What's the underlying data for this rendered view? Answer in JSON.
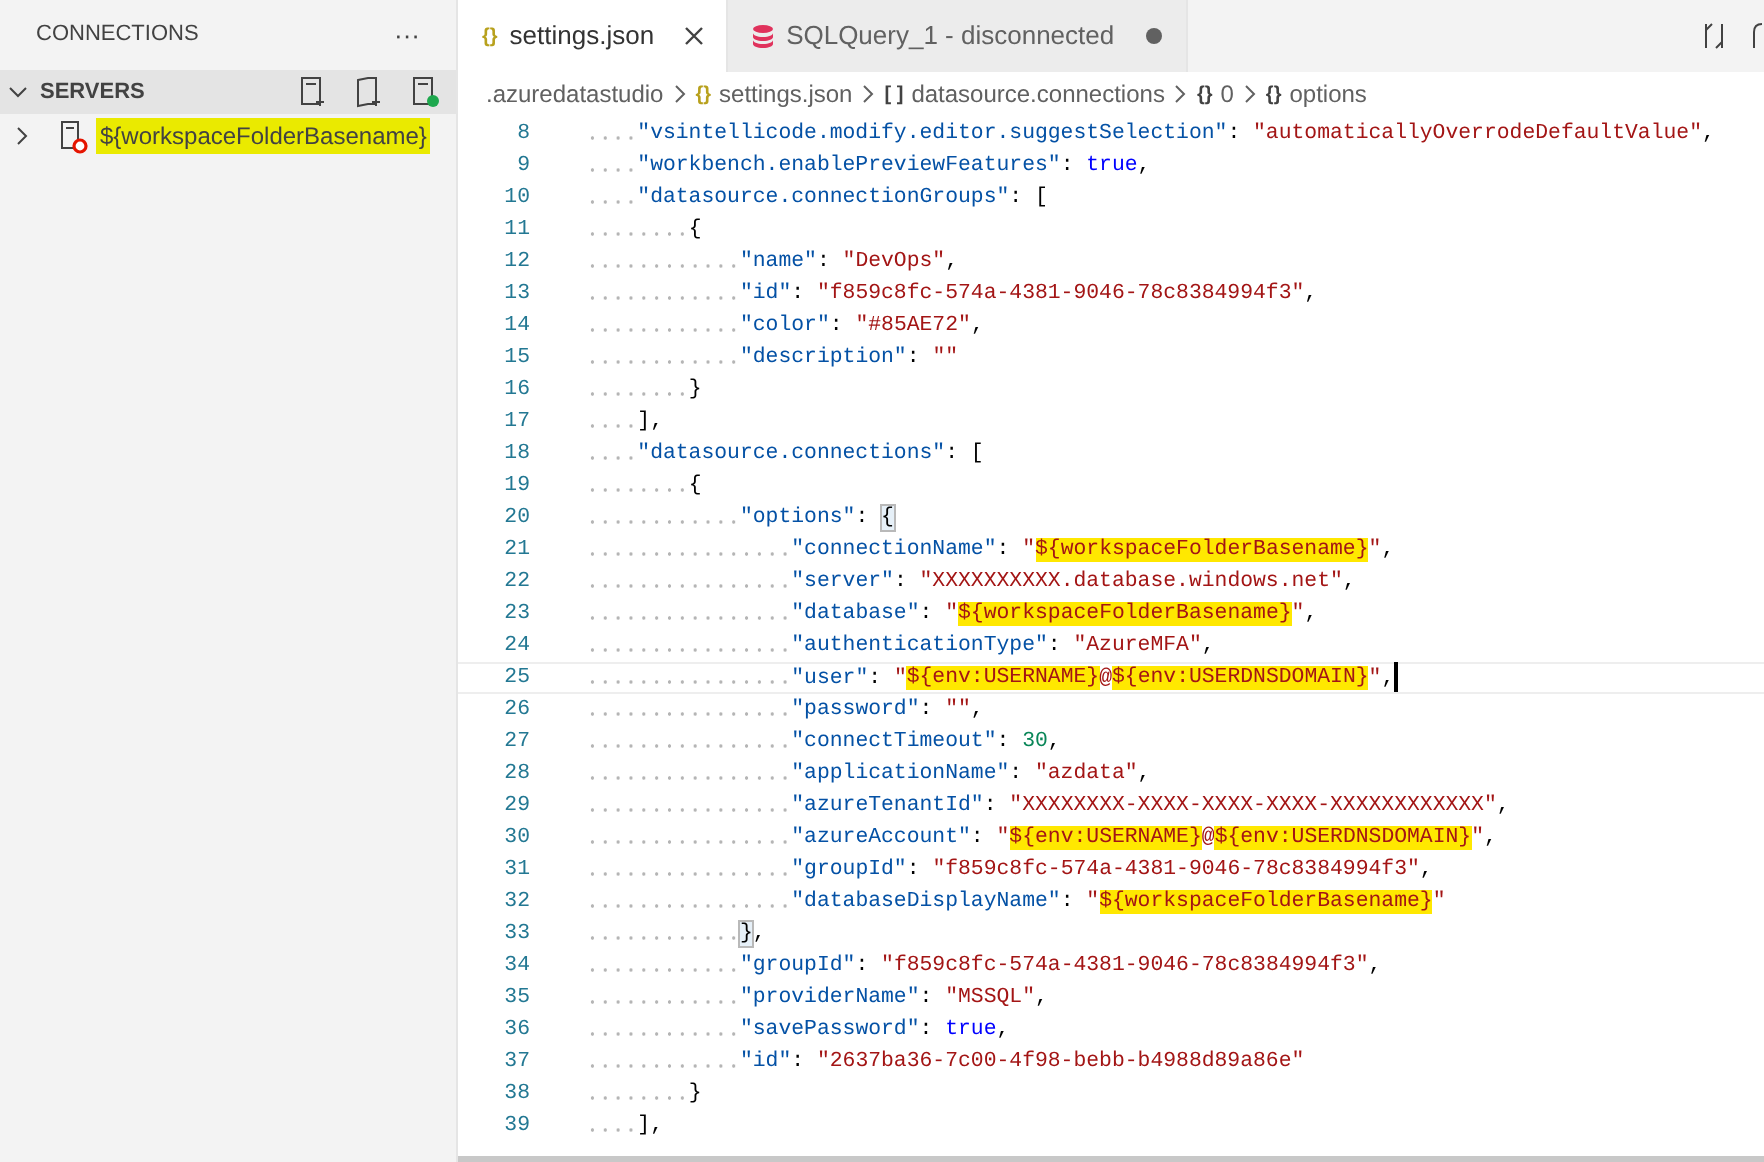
{
  "sidebar": {
    "title": "CONNECTIONS",
    "more": "···",
    "section": {
      "title": "SERVERS",
      "expanded": true
    },
    "items": [
      {
        "label": "${workspaceFolderBasename}",
        "expanded": false,
        "highlighted": true
      }
    ]
  },
  "tabs": [
    {
      "icon": "{}",
      "label": "settings.json",
      "selected": true,
      "kind": "json",
      "dirty": false
    },
    {
      "label": "SQLQuery_1 - disconnected",
      "selected": false,
      "kind": "sql",
      "dirty": true
    }
  ],
  "breadcrumbs": [
    {
      "label": ".azuredatastudio"
    },
    {
      "icon": "{}",
      "label": "settings.json"
    },
    {
      "icon": "[ ]",
      "label": "datasource.connections"
    },
    {
      "icon": "{}",
      "label": "0"
    },
    {
      "icon": "{}",
      "label": "options"
    }
  ],
  "lines": [
    {
      "n": "8",
      "current": false,
      "tokens": [
        {
          "kind": "key",
          "text": "\"vsintellicode.modify.editor.suggestSelection\""
        },
        {
          "kind": "punct",
          "text": ": "
        },
        {
          "kind": "string",
          "text": "\"automaticallyOverrodeDefaultValue\""
        },
        {
          "kind": "punct",
          "text": ","
        }
      ]
    },
    {
      "n": "9",
      "current": false,
      "tokens": [
        {
          "kind": "key",
          "text": "\"workbench.enablePreviewFeatures\""
        },
        {
          "kind": "punct",
          "text": ": "
        },
        {
          "kind": "keyword",
          "text": "true"
        },
        {
          "kind": "punct",
          "text": ","
        }
      ]
    },
    {
      "n": "10",
      "current": false,
      "tokens": [
        {
          "kind": "key",
          "text": "\"datasource.connectionGroups\""
        },
        {
          "kind": "punct",
          "text": ": ["
        }
      ]
    },
    {
      "n": "11",
      "current": false,
      "tokens": [
        {
          "kind": "punct",
          "text": "{"
        }
      ]
    },
    {
      "n": "12",
      "current": false,
      "tokens": [
        {
          "kind": "key",
          "text": "\"name\""
        },
        {
          "kind": "punct",
          "text": ": "
        },
        {
          "kind": "string",
          "text": "\"DevOps\""
        },
        {
          "kind": "punct",
          "text": ","
        }
      ]
    },
    {
      "n": "13",
      "current": false,
      "tokens": [
        {
          "kind": "key",
          "text": "\"id\""
        },
        {
          "kind": "punct",
          "text": ": "
        },
        {
          "kind": "string",
          "text": "\"f859c8fc-574a-4381-9046-78c8384994f3\""
        },
        {
          "kind": "punct",
          "text": ","
        }
      ]
    },
    {
      "n": "14",
      "current": false,
      "tokens": [
        {
          "kind": "key",
          "text": "\"color\""
        },
        {
          "kind": "punct",
          "text": ": "
        },
        {
          "kind": "string",
          "text": "\"#85AE72\""
        },
        {
          "kind": "punct",
          "text": ","
        }
      ]
    },
    {
      "n": "15",
      "current": false,
      "tokens": [
        {
          "kind": "key",
          "text": "\"description\""
        },
        {
          "kind": "punct",
          "text": ": "
        },
        {
          "kind": "string",
          "text": "\"\""
        }
      ]
    },
    {
      "n": "16",
      "current": false,
      "tokens": [
        {
          "kind": "punct",
          "text": "}"
        }
      ]
    },
    {
      "n": "17",
      "current": false,
      "tokens": [
        {
          "kind": "punct",
          "text": "],"
        }
      ]
    },
    {
      "n": "18",
      "current": false,
      "tokens": [
        {
          "kind": "key",
          "text": "\"datasource.connections\""
        },
        {
          "kind": "punct",
          "text": ": ["
        }
      ]
    },
    {
      "n": "19",
      "current": false,
      "tokens": [
        {
          "kind": "punct",
          "text": "{"
        }
      ]
    },
    {
      "n": "20",
      "current": false,
      "tokens": [
        {
          "kind": "key",
          "text": "\"options\""
        },
        {
          "kind": "punct",
          "text": ": "
        },
        {
          "kind": "match",
          "text": "{"
        }
      ]
    },
    {
      "n": "21",
      "current": false,
      "tokens": [
        {
          "kind": "key",
          "text": "\"connectionName\""
        },
        {
          "kind": "punct",
          "text": ": "
        },
        {
          "kind": "string",
          "text": "\""
        },
        {
          "kind": "highlight",
          "text": "${workspaceFolderBasename}"
        },
        {
          "kind": "string",
          "text": "\""
        },
        {
          "kind": "punct",
          "text": ","
        }
      ]
    },
    {
      "n": "22",
      "current": false,
      "tokens": [
        {
          "kind": "key",
          "text": "\"server\""
        },
        {
          "kind": "punct",
          "text": ": "
        },
        {
          "kind": "string",
          "text": "\"XXXXXXXXXX.database.windows.net\""
        },
        {
          "kind": "punct",
          "text": ","
        }
      ]
    },
    {
      "n": "23",
      "current": false,
      "tokens": [
        {
          "kind": "key",
          "text": "\"database\""
        },
        {
          "kind": "punct",
          "text": ": "
        },
        {
          "kind": "string",
          "text": "\""
        },
        {
          "kind": "highlight",
          "text": "${workspaceFolderBasename}"
        },
        {
          "kind": "string",
          "text": "\""
        },
        {
          "kind": "punct",
          "text": ","
        }
      ]
    },
    {
      "n": "24",
      "current": false,
      "tokens": [
        {
          "kind": "key",
          "text": "\"authenticationType\""
        },
        {
          "kind": "punct",
          "text": ": "
        },
        {
          "kind": "string",
          "text": "\"AzureMFA\""
        },
        {
          "kind": "punct",
          "text": ","
        }
      ]
    },
    {
      "n": "25",
      "current": true,
      "tokens": [
        {
          "kind": "key",
          "text": "\"user\""
        },
        {
          "kind": "punct",
          "text": ": "
        },
        {
          "kind": "string",
          "text": "\""
        },
        {
          "kind": "highlight",
          "text": "${env:USERNAME}"
        },
        {
          "kind": "string",
          "text": "@"
        },
        {
          "kind": "highlight",
          "text": "${env:USERDNSDOMAIN}"
        },
        {
          "kind": "string",
          "text": "\""
        },
        {
          "kind": "punct",
          "text": ","
        }
      ]
    },
    {
      "n": "26",
      "current": false,
      "tokens": [
        {
          "kind": "key",
          "text": "\"password\""
        },
        {
          "kind": "punct",
          "text": ": "
        },
        {
          "kind": "string",
          "text": "\"\""
        },
        {
          "kind": "punct",
          "text": ","
        }
      ]
    },
    {
      "n": "27",
      "current": false,
      "tokens": [
        {
          "kind": "key",
          "text": "\"connectTimeout\""
        },
        {
          "kind": "punct",
          "text": ": "
        },
        {
          "kind": "number",
          "text": "30"
        },
        {
          "kind": "punct",
          "text": ","
        }
      ]
    },
    {
      "n": "28",
      "current": false,
      "tokens": [
        {
          "kind": "key",
          "text": "\"applicationName\""
        },
        {
          "kind": "punct",
          "text": ": "
        },
        {
          "kind": "string",
          "text": "\"azdata\""
        },
        {
          "kind": "punct",
          "text": ","
        }
      ]
    },
    {
      "n": "29",
      "current": false,
      "tokens": [
        {
          "kind": "key",
          "text": "\"azureTenantId\""
        },
        {
          "kind": "punct",
          "text": ": "
        },
        {
          "kind": "string",
          "text": "\"XXXXXXXX-XXXX-XXXX-XXXX-XXXXXXXXXXXX\""
        },
        {
          "kind": "punct",
          "text": ","
        }
      ]
    },
    {
      "n": "30",
      "current": false,
      "tokens": [
        {
          "kind": "key",
          "text": "\"azureAccount\""
        },
        {
          "kind": "punct",
          "text": ": "
        },
        {
          "kind": "string",
          "text": "\""
        },
        {
          "kind": "highlight",
          "text": "${env:USERNAME}"
        },
        {
          "kind": "string",
          "text": "@"
        },
        {
          "kind": "highlight",
          "text": "${env:USERDNSDOMAIN}"
        },
        {
          "kind": "string",
          "text": "\""
        },
        {
          "kind": "punct",
          "text": ","
        }
      ]
    },
    {
      "n": "31",
      "current": false,
      "tokens": [
        {
          "kind": "key",
          "text": "\"groupId\""
        },
        {
          "kind": "punct",
          "text": ": "
        },
        {
          "kind": "string",
          "text": "\"f859c8fc-574a-4381-9046-78c8384994f3\""
        },
        {
          "kind": "punct",
          "text": ","
        }
      ]
    },
    {
      "n": "32",
      "current": false,
      "tokens": [
        {
          "kind": "key",
          "text": "\"databaseDisplayName\""
        },
        {
          "kind": "punct",
          "text": ": "
        },
        {
          "kind": "string",
          "text": "\""
        },
        {
          "kind": "highlight",
          "text": "${workspaceFolderBasename}"
        },
        {
          "kind": "string",
          "text": "\""
        }
      ]
    },
    {
      "n": "33",
      "current": false,
      "tokens": [
        {
          "kind": "match",
          "text": "}"
        },
        {
          "kind": "punct",
          "text": ","
        }
      ]
    },
    {
      "n": "34",
      "current": false,
      "tokens": [
        {
          "kind": "key",
          "text": "\"groupId\""
        },
        {
          "kind": "punct",
          "text": ": "
        },
        {
          "kind": "string",
          "text": "\"f859c8fc-574a-4381-9046-78c8384994f3\""
        },
        {
          "kind": "punct",
          "text": ","
        }
      ]
    },
    {
      "n": "35",
      "current": false,
      "tokens": [
        {
          "kind": "key",
          "text": "\"providerName\""
        },
        {
          "kind": "punct",
          "text": ": "
        },
        {
          "kind": "string",
          "text": "\"MSSQL\""
        },
        {
          "kind": "punct",
          "text": ","
        }
      ]
    },
    {
      "n": "36",
      "current": false,
      "tokens": [
        {
          "kind": "key",
          "text": "\"savePassword\""
        },
        {
          "kind": "punct",
          "text": ": "
        },
        {
          "kind": "keyword",
          "text": "true"
        },
        {
          "kind": "punct",
          "text": ","
        }
      ]
    },
    {
      "n": "37",
      "current": false,
      "tokens": [
        {
          "kind": "key",
          "text": "\"id\""
        },
        {
          "kind": "punct",
          "text": ": "
        },
        {
          "kind": "string",
          "text": "\"2637ba36-7c00-4f98-bebb-b4988d89a86e\""
        }
      ]
    },
    {
      "n": "38",
      "current": false,
      "tokens": [
        {
          "kind": "punct",
          "text": "}"
        }
      ]
    },
    {
      "n": "39",
      "current": false,
      "tokens": [
        {
          "kind": "punct",
          "text": "],"
        }
      ]
    }
  ]
}
